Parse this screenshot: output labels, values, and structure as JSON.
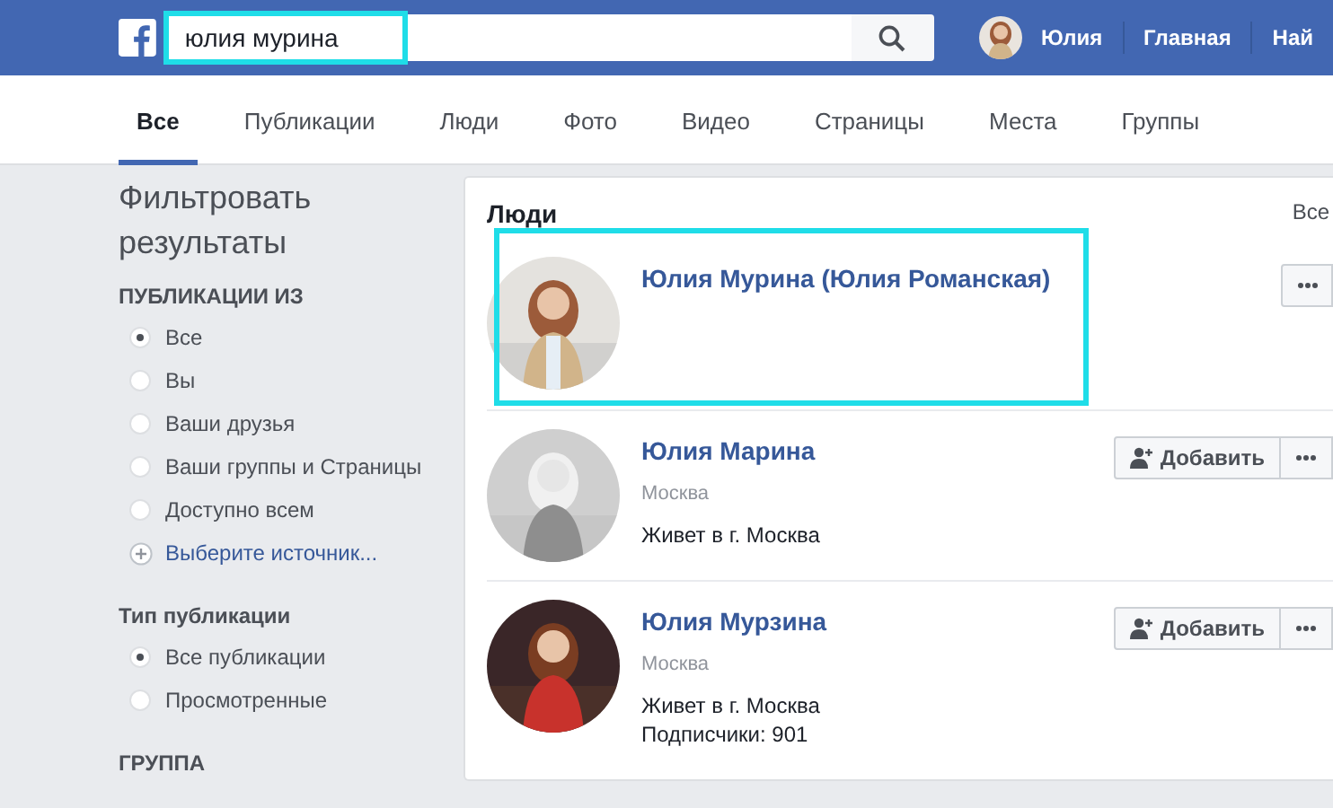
{
  "header": {
    "search": {
      "value": "юлия мурина",
      "highlighted": true
    },
    "profile": {
      "name": "Юлия"
    },
    "nav": [
      "Главная",
      "Най"
    ]
  },
  "tabs": [
    {
      "label": "Все",
      "selected": true
    },
    {
      "label": "Публикации",
      "selected": false
    },
    {
      "label": "Люди",
      "selected": false
    },
    {
      "label": "Фото",
      "selected": false
    },
    {
      "label": "Видео",
      "selected": false
    },
    {
      "label": "Страницы",
      "selected": false
    },
    {
      "label": "Места",
      "selected": false
    },
    {
      "label": "Группы",
      "selected": false
    }
  ],
  "filters": {
    "title": "Фильтровать результаты",
    "sections": [
      {
        "title": "ПУБЛИКАЦИИ ИЗ",
        "options": [
          {
            "label": "Все",
            "selected": true
          },
          {
            "label": "Вы",
            "selected": false
          },
          {
            "label": "Ваши друзья",
            "selected": false
          },
          {
            "label": "Ваши группы и Страницы",
            "selected": false
          },
          {
            "label": "Доступно всем",
            "selected": false
          }
        ],
        "link": "Выберите источник..."
      },
      {
        "title": "Тип публикации",
        "options": [
          {
            "label": "Все публикации",
            "selected": true
          },
          {
            "label": "Просмотренные",
            "selected": false
          }
        ]
      },
      {
        "title": "ГРУППА"
      }
    ]
  },
  "people": {
    "title": "Люди",
    "see_all": "Все",
    "persons": [
      {
        "name": "Юлия Мурина (Юлия Романская)",
        "highlighted": true,
        "photo": {
          "kind": "picture"
        }
      },
      {
        "name": "Юлия Марина",
        "highlighted": false,
        "photo": {
          "kind": "picture"
        },
        "details": [
          {
            "kind": "location",
            "text": "Москва"
          },
          {
            "kind": "info",
            "text": "Живет в г. Москва"
          }
        ],
        "add_button": "Добавить"
      },
      {
        "name": "Юлия Мурзина",
        "highlighted": false,
        "photo": {
          "kind": "picture"
        },
        "details": [
          {
            "kind": "location",
            "text": "Москва"
          },
          {
            "kind": "info",
            "text": "Живет в г. Москва"
          },
          {
            "kind": "info_tight",
            "text": "Подписчики: 901"
          }
        ],
        "add_button": "Добавить"
      }
    ]
  }
}
